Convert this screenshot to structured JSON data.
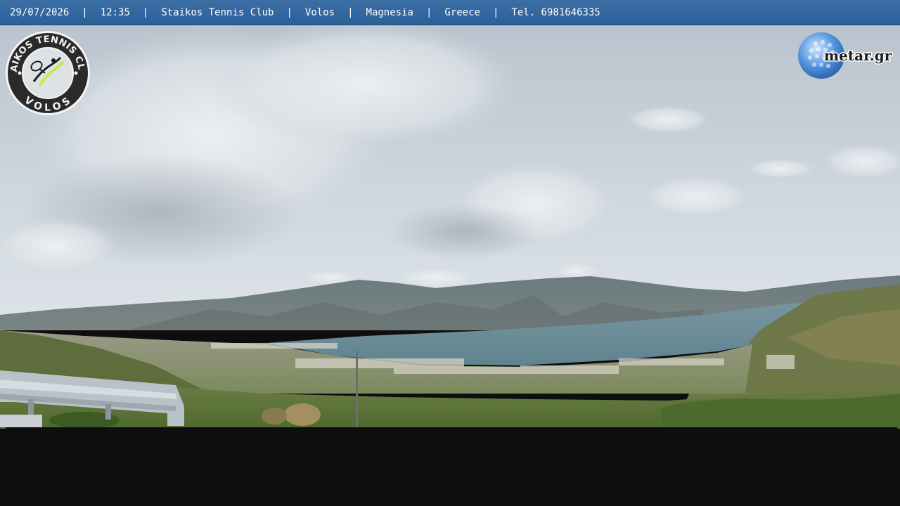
{
  "overlay": {
    "date": "29/07/2026",
    "time": "12:35",
    "venue": "Staikos Tennis Club",
    "city": "Volos",
    "region": "Magnesia",
    "country": "Greece",
    "phone": "Tel. 6981646335",
    "separator": "|"
  },
  "club_logo": {
    "text_top": "STAIKOS TENNIS CLUB",
    "text_bottom": "VOLOS",
    "accent": "#c8e84a"
  },
  "metar_logo": {
    "text": "metar.gr",
    "ball_color": "#4a90d9"
  },
  "colors": {
    "bar": "#2d5f98",
    "sea": "#6a8c98",
    "sky": "#c9d3db",
    "vegetation": "#5c7a3a"
  }
}
